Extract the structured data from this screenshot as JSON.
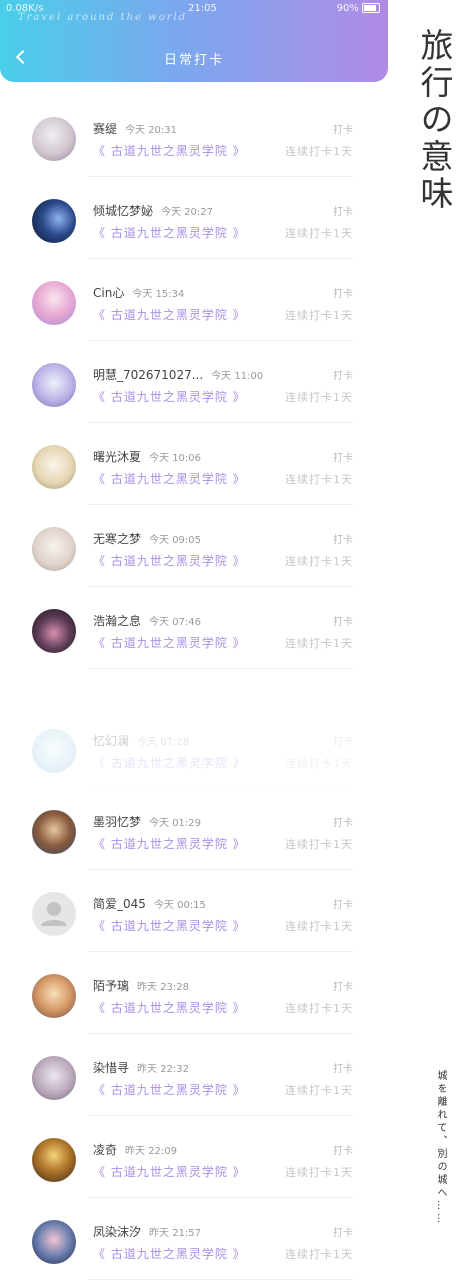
{
  "status": {
    "speed": "0.08K/s",
    "time": "21:05",
    "battery": "90%"
  },
  "watermark": "Travel around the world",
  "header": {
    "title": "日常打卡"
  },
  "group_label": "《 古道九世之黑灵学院 》",
  "checkin_label": "打卡",
  "streak_label": "连续打卡1天",
  "entries": [
    {
      "name": "赛缇",
      "time": "今天 20:31"
    },
    {
      "name": "倾城忆梦妼",
      "time": "今天 20:27"
    },
    {
      "name": "Cin心",
      "time": "今天 15:34"
    },
    {
      "name": "明慧_702671027...",
      "time": "今天 11:00"
    },
    {
      "name": "曙光沐夏",
      "time": "今天 10:06"
    },
    {
      "name": "无寒之梦",
      "time": "今天 09:05"
    },
    {
      "name": "浩瀚之息",
      "time": "今天 07:46"
    },
    {
      "name": "忆幻澜",
      "time": "今天 07:28"
    },
    {
      "name": "墨羽忆梦",
      "time": "今天 01:29"
    },
    {
      "name": "简爱_045",
      "time": "今天 00:15"
    },
    {
      "name": "陌予璃",
      "time": "昨天 23:28"
    },
    {
      "name": "染惜寻",
      "time": "昨天 22:32"
    },
    {
      "name": "凌奇",
      "time": "昨天 22:09"
    },
    {
      "name": "凤染沫汐",
      "time": "昨天 21:57"
    }
  ],
  "side": {
    "title": "旅行の意味",
    "subtitle": "城を離れて、別の城へ……"
  },
  "colors": {
    "gradient_start": "#49cfe9",
    "gradient_end": "#b08ae6",
    "group_text": "#a98ee6"
  }
}
